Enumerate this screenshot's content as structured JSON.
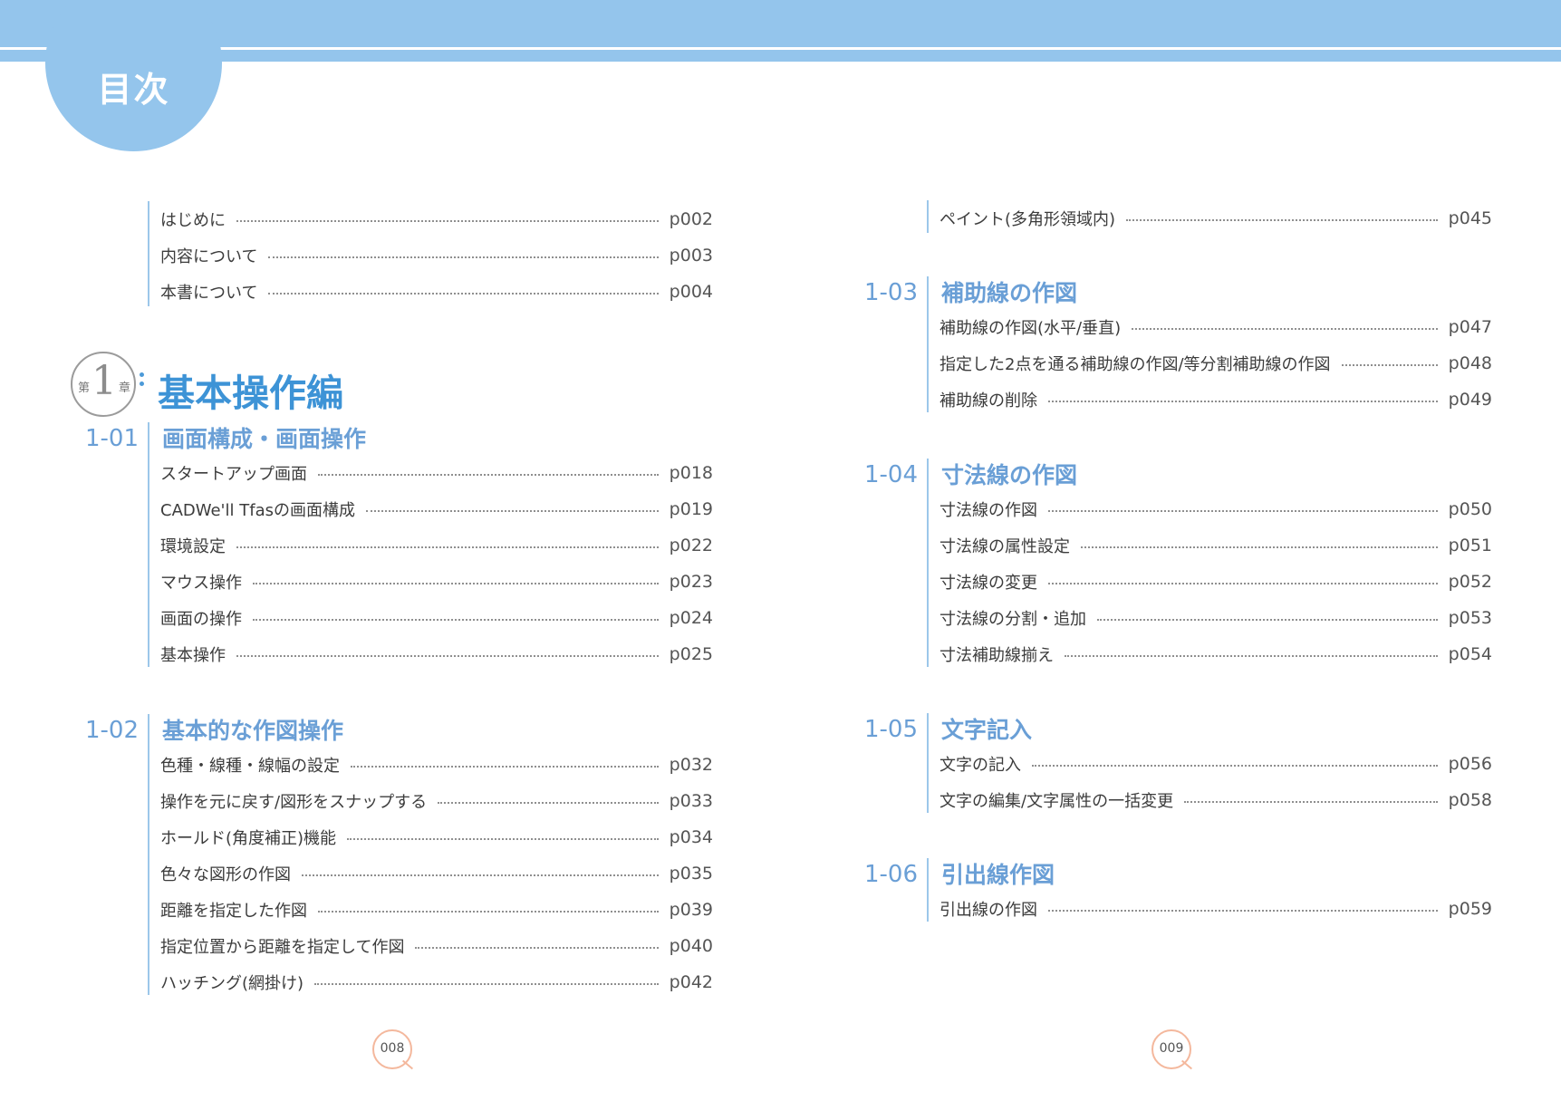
{
  "header": {
    "title": "目次"
  },
  "chapter": {
    "prefix": "第",
    "number": "1",
    "suffix": "章",
    "title": "基本操作編"
  },
  "left": {
    "intro": [
      {
        "label": "はじめに",
        "page": "p002"
      },
      {
        "label": "内容について",
        "page": "p003"
      },
      {
        "label": "本書について",
        "page": "p004"
      }
    ],
    "sections": [
      {
        "number": "1-01",
        "title": "画面構成・画面操作",
        "items": [
          {
            "label": "スタートアップ画面",
            "page": "p018"
          },
          {
            "label": "CADWe'll Tfasの画面構成",
            "page": "p019"
          },
          {
            "label": "環境設定",
            "page": "p022"
          },
          {
            "label": "マウス操作",
            "page": "p023"
          },
          {
            "label": "画面の操作",
            "page": "p024"
          },
          {
            "label": "基本操作",
            "page": "p025"
          }
        ]
      },
      {
        "number": "1-02",
        "title": "基本的な作図操作",
        "items": [
          {
            "label": "色種・線種・線幅の設定",
            "page": "p032"
          },
          {
            "label": "操作を元に戻す/図形をスナップする",
            "page": "p033"
          },
          {
            "label": "ホールド(角度補正)機能",
            "page": "p034"
          },
          {
            "label": "色々な図形の作図",
            "page": "p035"
          },
          {
            "label": "距離を指定した作図",
            "page": "p039"
          },
          {
            "label": "指定位置から距離を指定して作図",
            "page": "p040"
          },
          {
            "label": "ハッチング(網掛け)",
            "page": "p042"
          }
        ]
      }
    ]
  },
  "right": {
    "cont": [
      {
        "label": "ペイント(多角形領域内)",
        "page": "p045"
      }
    ],
    "sections": [
      {
        "number": "1-03",
        "title": "補助線の作図",
        "items": [
          {
            "label": "補助線の作図(水平/垂直)",
            "page": "p047"
          },
          {
            "label": "指定した2点を通る補助線の作図/等分割補助線の作図",
            "page": "p048"
          },
          {
            "label": "補助線の削除",
            "page": "p049"
          }
        ]
      },
      {
        "number": "1-04",
        "title": "寸法線の作図",
        "items": [
          {
            "label": "寸法線の作図",
            "page": "p050"
          },
          {
            "label": "寸法線の属性設定",
            "page": "p051"
          },
          {
            "label": "寸法線の変更",
            "page": "p052"
          },
          {
            "label": "寸法線の分割・追加",
            "page": "p053"
          },
          {
            "label": "寸法補助線揃え",
            "page": "p054"
          }
        ]
      },
      {
        "number": "1-05",
        "title": "文字記入",
        "items": [
          {
            "label": "文字の記入",
            "page": "p056"
          },
          {
            "label": "文字の編集/文字属性の一括変更",
            "page": "p058"
          }
        ]
      },
      {
        "number": "1-06",
        "title": "引出線作図",
        "items": [
          {
            "label": "引出線の作図",
            "page": "p059"
          }
        ]
      }
    ]
  },
  "footer": {
    "left_page": "008",
    "right_page": "009"
  }
}
